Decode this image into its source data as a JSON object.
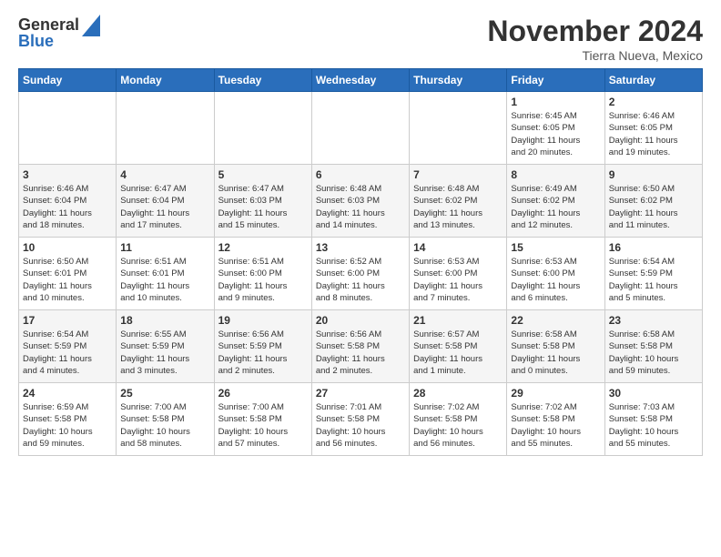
{
  "logo": {
    "general": "General",
    "blue": "Blue"
  },
  "title": "November 2024",
  "subtitle": "Tierra Nueva, Mexico",
  "weekdays": [
    "Sunday",
    "Monday",
    "Tuesday",
    "Wednesday",
    "Thursday",
    "Friday",
    "Saturday"
  ],
  "weeks": [
    [
      {
        "day": "",
        "info": ""
      },
      {
        "day": "",
        "info": ""
      },
      {
        "day": "",
        "info": ""
      },
      {
        "day": "",
        "info": ""
      },
      {
        "day": "",
        "info": ""
      },
      {
        "day": "1",
        "info": "Sunrise: 6:45 AM\nSunset: 6:05 PM\nDaylight: 11 hours\nand 20 minutes."
      },
      {
        "day": "2",
        "info": "Sunrise: 6:46 AM\nSunset: 6:05 PM\nDaylight: 11 hours\nand 19 minutes."
      }
    ],
    [
      {
        "day": "3",
        "info": "Sunrise: 6:46 AM\nSunset: 6:04 PM\nDaylight: 11 hours\nand 18 minutes."
      },
      {
        "day": "4",
        "info": "Sunrise: 6:47 AM\nSunset: 6:04 PM\nDaylight: 11 hours\nand 17 minutes."
      },
      {
        "day": "5",
        "info": "Sunrise: 6:47 AM\nSunset: 6:03 PM\nDaylight: 11 hours\nand 15 minutes."
      },
      {
        "day": "6",
        "info": "Sunrise: 6:48 AM\nSunset: 6:03 PM\nDaylight: 11 hours\nand 14 minutes."
      },
      {
        "day": "7",
        "info": "Sunrise: 6:48 AM\nSunset: 6:02 PM\nDaylight: 11 hours\nand 13 minutes."
      },
      {
        "day": "8",
        "info": "Sunrise: 6:49 AM\nSunset: 6:02 PM\nDaylight: 11 hours\nand 12 minutes."
      },
      {
        "day": "9",
        "info": "Sunrise: 6:50 AM\nSunset: 6:02 PM\nDaylight: 11 hours\nand 11 minutes."
      }
    ],
    [
      {
        "day": "10",
        "info": "Sunrise: 6:50 AM\nSunset: 6:01 PM\nDaylight: 11 hours\nand 10 minutes."
      },
      {
        "day": "11",
        "info": "Sunrise: 6:51 AM\nSunset: 6:01 PM\nDaylight: 11 hours\nand 10 minutes."
      },
      {
        "day": "12",
        "info": "Sunrise: 6:51 AM\nSunset: 6:00 PM\nDaylight: 11 hours\nand 9 minutes."
      },
      {
        "day": "13",
        "info": "Sunrise: 6:52 AM\nSunset: 6:00 PM\nDaylight: 11 hours\nand 8 minutes."
      },
      {
        "day": "14",
        "info": "Sunrise: 6:53 AM\nSunset: 6:00 PM\nDaylight: 11 hours\nand 7 minutes."
      },
      {
        "day": "15",
        "info": "Sunrise: 6:53 AM\nSunset: 6:00 PM\nDaylight: 11 hours\nand 6 minutes."
      },
      {
        "day": "16",
        "info": "Sunrise: 6:54 AM\nSunset: 5:59 PM\nDaylight: 11 hours\nand 5 minutes."
      }
    ],
    [
      {
        "day": "17",
        "info": "Sunrise: 6:54 AM\nSunset: 5:59 PM\nDaylight: 11 hours\nand 4 minutes."
      },
      {
        "day": "18",
        "info": "Sunrise: 6:55 AM\nSunset: 5:59 PM\nDaylight: 11 hours\nand 3 minutes."
      },
      {
        "day": "19",
        "info": "Sunrise: 6:56 AM\nSunset: 5:59 PM\nDaylight: 11 hours\nand 2 minutes."
      },
      {
        "day": "20",
        "info": "Sunrise: 6:56 AM\nSunset: 5:58 PM\nDaylight: 11 hours\nand 2 minutes."
      },
      {
        "day": "21",
        "info": "Sunrise: 6:57 AM\nSunset: 5:58 PM\nDaylight: 11 hours\nand 1 minute."
      },
      {
        "day": "22",
        "info": "Sunrise: 6:58 AM\nSunset: 5:58 PM\nDaylight: 11 hours\nand 0 minutes."
      },
      {
        "day": "23",
        "info": "Sunrise: 6:58 AM\nSunset: 5:58 PM\nDaylight: 10 hours\nand 59 minutes."
      }
    ],
    [
      {
        "day": "24",
        "info": "Sunrise: 6:59 AM\nSunset: 5:58 PM\nDaylight: 10 hours\nand 59 minutes."
      },
      {
        "day": "25",
        "info": "Sunrise: 7:00 AM\nSunset: 5:58 PM\nDaylight: 10 hours\nand 58 minutes."
      },
      {
        "day": "26",
        "info": "Sunrise: 7:00 AM\nSunset: 5:58 PM\nDaylight: 10 hours\nand 57 minutes."
      },
      {
        "day": "27",
        "info": "Sunrise: 7:01 AM\nSunset: 5:58 PM\nDaylight: 10 hours\nand 56 minutes."
      },
      {
        "day": "28",
        "info": "Sunrise: 7:02 AM\nSunset: 5:58 PM\nDaylight: 10 hours\nand 56 minutes."
      },
      {
        "day": "29",
        "info": "Sunrise: 7:02 AM\nSunset: 5:58 PM\nDaylight: 10 hours\nand 55 minutes."
      },
      {
        "day": "30",
        "info": "Sunrise: 7:03 AM\nSunset: 5:58 PM\nDaylight: 10 hours\nand 55 minutes."
      }
    ]
  ]
}
